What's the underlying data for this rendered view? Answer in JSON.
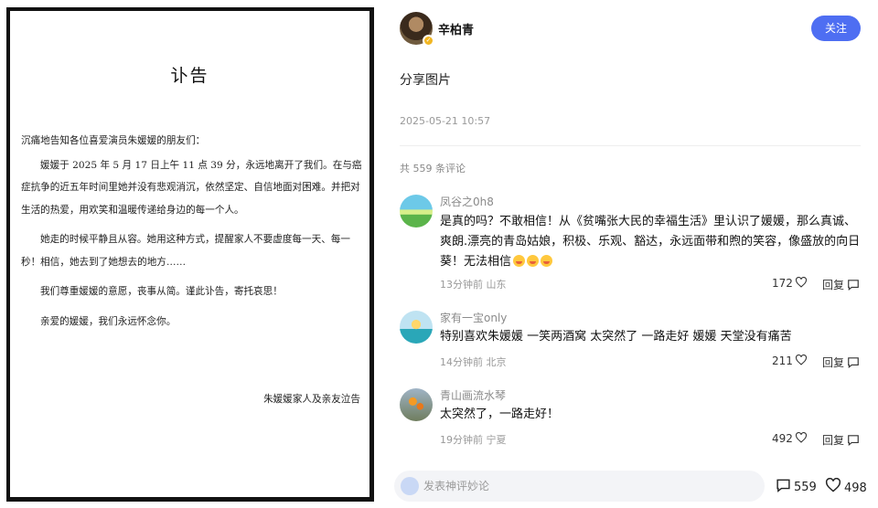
{
  "document": {
    "title": "讣告",
    "greeting": "沉痛地告知各位喜爱演员朱媛媛的朋友们：",
    "paragraphs": [
      "媛媛于 2025 年 5 月 17 日上午 11 点 39 分，永远地离开了我们。在与癌症抗争的近五年时间里她并没有悲观消沉，依然坚定、自信地面对困难。并把对生活的热爱，用欢笑和温暖传递给身边的每一个人。",
      "她走的时候平静且从容。她用这种方式，提醒家人不要虚度每一天、每一秒！相信，她去到了她想去的地方……",
      "我们尊重媛媛的意愿，丧事从简。谨此讣告，寄托哀思！",
      "亲爱的媛媛，我们永远怀念你。"
    ],
    "signature": "朱媛媛家人及亲友泣告"
  },
  "post": {
    "username": "辛柏青",
    "follow_label": "关注",
    "text": "分享图片",
    "timestamp": "2025-05-21 10:57",
    "comment_count_label": "共 559 条评论"
  },
  "comments": [
    {
      "name": "凤谷之0h8",
      "text": "是真的吗？不敢相信！从《贫嘴张大民的幸福生活》里认识了媛媛，那么真诚、爽朗.漂亮的青岛姑娘，积极、乐观、豁达，永远面带和煦的笑容，像盛放的向日葵！无法相信",
      "meta": "13分钟前  山东",
      "likes": "172",
      "reply_label": "回复"
    },
    {
      "name": "家有一宝only",
      "text": "特别喜欢朱媛媛 一笑两酒窝 太突然了 一路走好 媛媛 天堂没有痛苦",
      "meta": "14分钟前  北京",
      "likes": "211",
      "reply_label": "回复"
    },
    {
      "name": "青山画流水琴",
      "text": "太突然了，一路走好！",
      "meta": "19分钟前  宁夏",
      "likes": "492",
      "reply_label": "回复"
    }
  ],
  "bottom_bar": {
    "placeholder": "发表神评妙论",
    "comments_total": "559",
    "likes_total": "498"
  },
  "colors": {
    "accent": "#4e6ef2",
    "verify_badge": "#f1b622"
  },
  "icons": [
    "heart-icon",
    "comment-bubble-icon",
    "verified-badge-icon",
    "crying-emoji-icon"
  ]
}
